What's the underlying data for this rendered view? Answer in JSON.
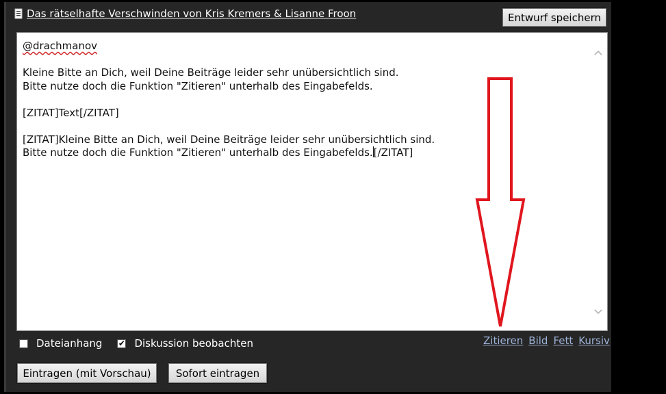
{
  "title": "Das rätselhafte Verschwinden von Kris Kremers & Lisanne Froon",
  "save_draft_label": "Entwurf speichern",
  "editor": {
    "mention": "@drachmanov",
    "line_1": "Kleine Bitte an Dich, weil Deine Beiträge leider sehr unübersichtlich sind.",
    "line_2": "Bitte nutze doch die Funktion \"Zitieren\" unterhalb des Eingabefelds.",
    "line_3": "[ZITAT]Text[/ZITAT]",
    "line_4": "[ZITAT]Kleine Bitte an Dich, weil Deine Beiträge leider sehr unübersichtlich sind.",
    "line_5a": "Bitte nutze doch die Funktion \"Zitieren\" unterhalb des Eingabefelds.",
    "line_5b": "[/ZITAT]"
  },
  "options": {
    "attachment_label": "Dateianhang",
    "attachment_checked": false,
    "watch_label": "Diskussion beobachten",
    "watch_checked": true,
    "check_glyph": "✔"
  },
  "format_links": {
    "quote": "Zitieren",
    "image": "Bild",
    "bold": "Fett",
    "italic": "Kursiv"
  },
  "submit_preview_label": "Eintragen (mit Vorschau)",
  "submit_now_label": "Sofort eintragen",
  "colors": {
    "panel_bg": "#262626",
    "link": "#9fb3d8",
    "annotation_arrow": "#e0161e"
  },
  "icons": {
    "title": "document-icon",
    "scroll_up": "chevron-up-icon",
    "scroll_down": "chevron-down-icon"
  }
}
